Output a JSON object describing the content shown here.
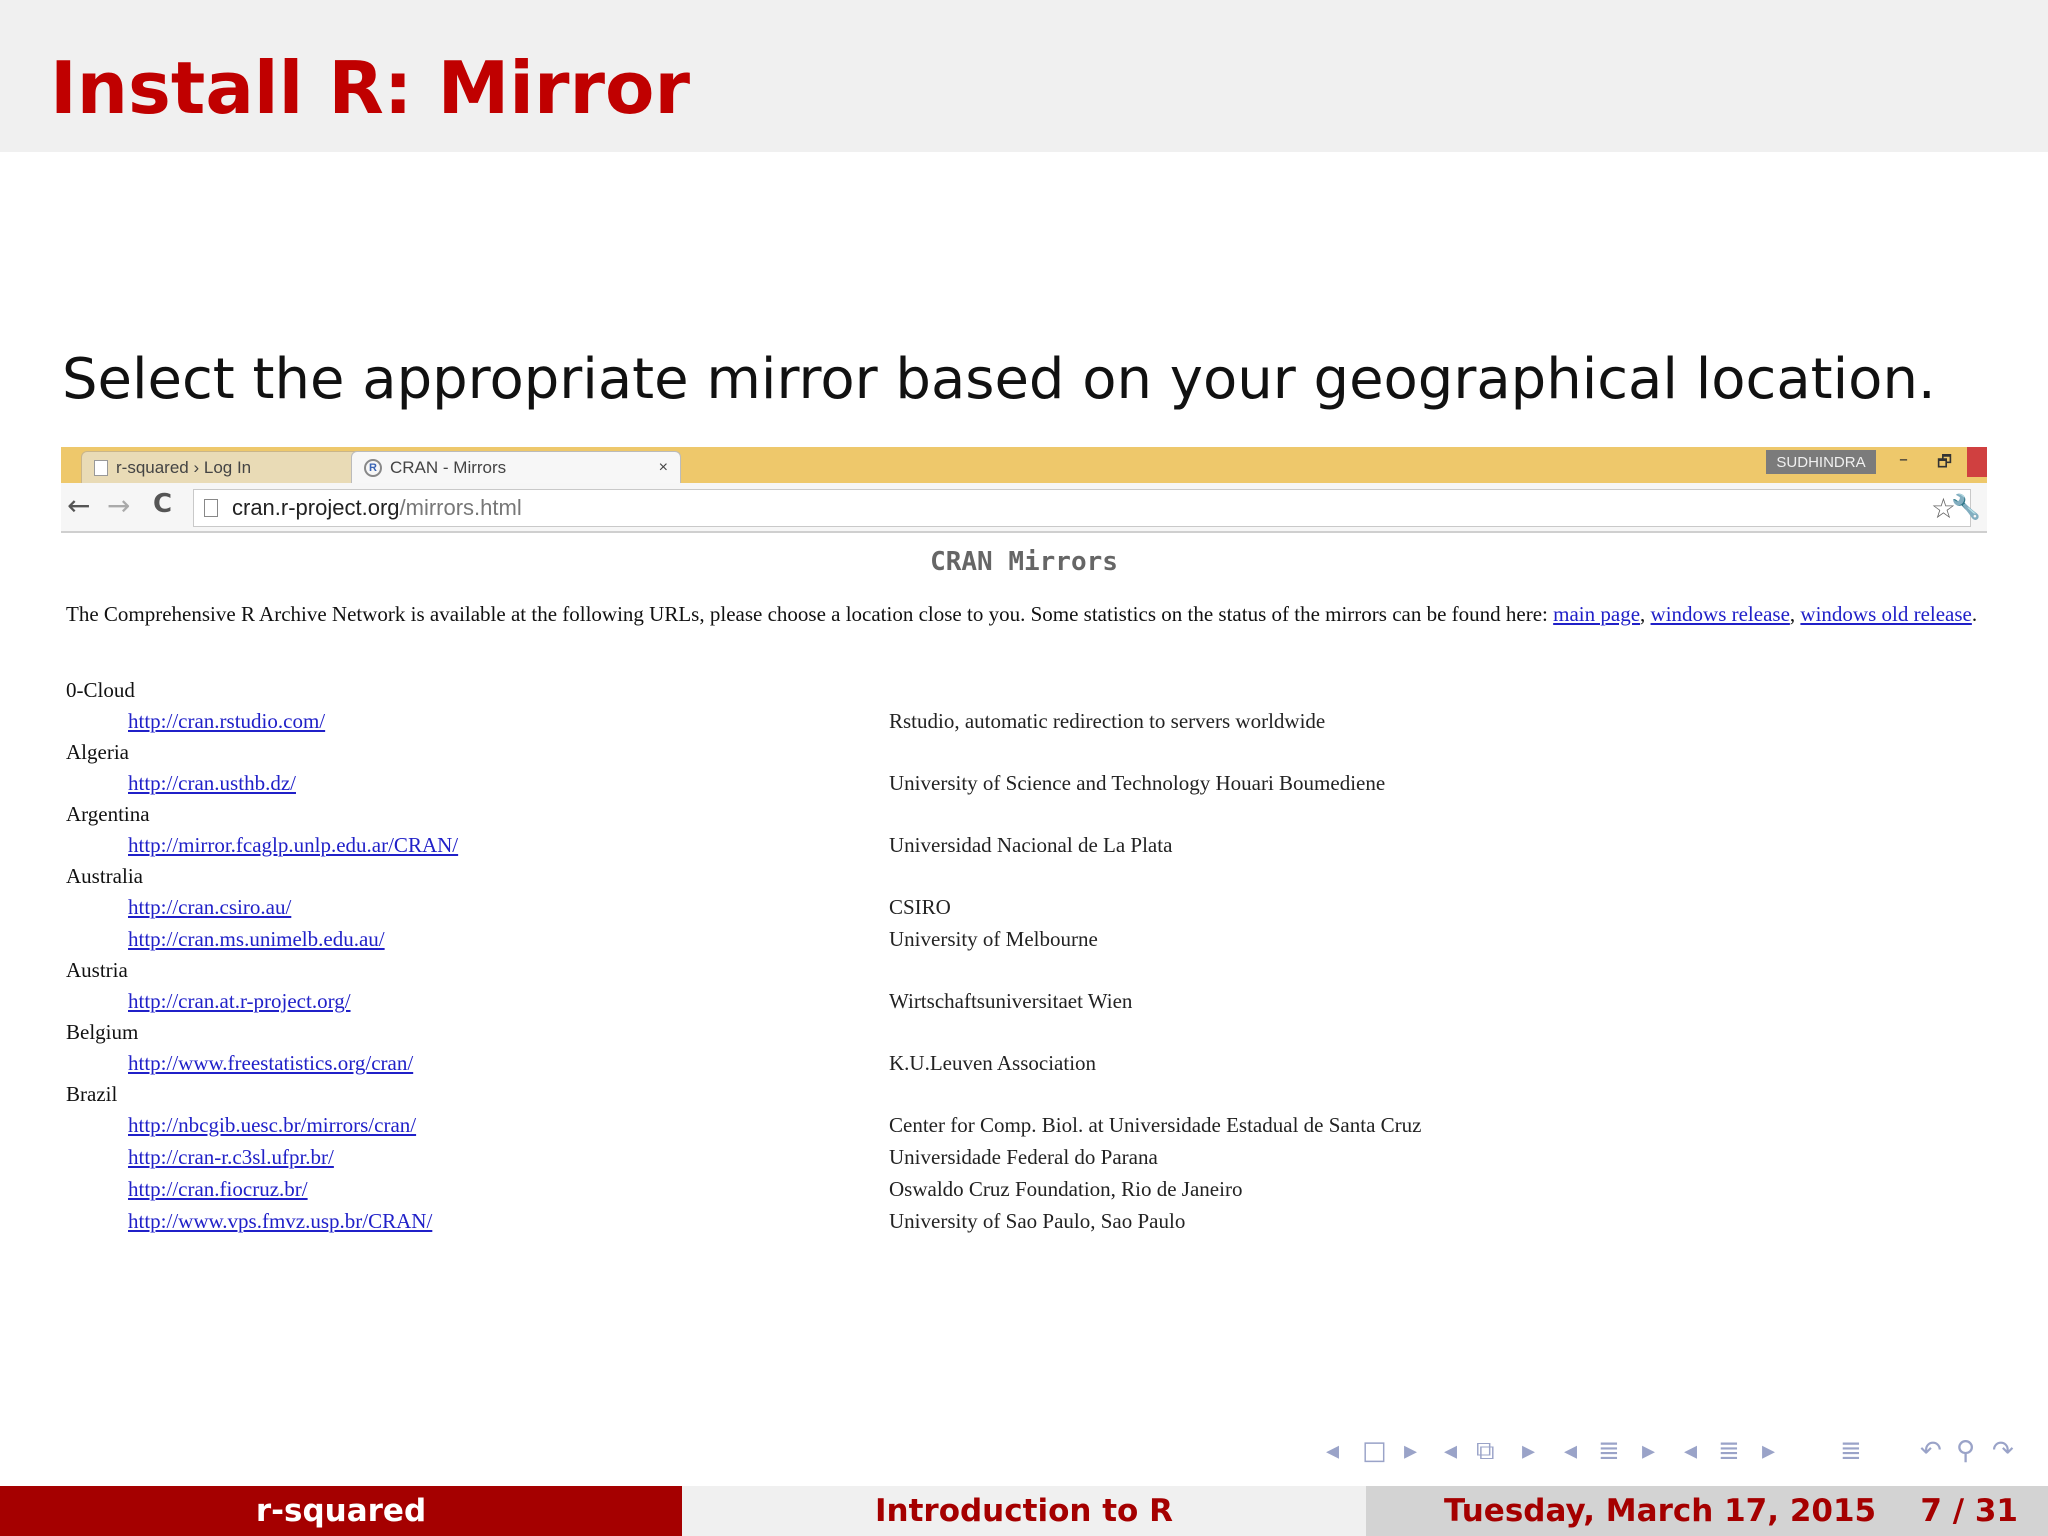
{
  "slide": {
    "title": "Install R: Mirror",
    "subtitle": "Select the appropriate mirror based on your geographical location."
  },
  "browser": {
    "tabs": [
      {
        "label": "r-squared › Log In",
        "active": false
      },
      {
        "label": "CRAN - Mirrors",
        "active": true
      }
    ],
    "user": "SUDHINDRA",
    "address": {
      "host": "cran.r-project.org",
      "path": "/mirrors.html"
    },
    "page": {
      "heading": "CRAN Mirrors",
      "intro": "The Comprehensive R Archive Network is available at the following URLs, please choose a location close to you. Some statistics on the status of the mirrors can be found here: ",
      "link_main": "main page",
      "link_windows": "windows release",
      "link_windows_old": "windows old release",
      "sep": ", ",
      "end": ".",
      "countries": [
        {
          "name": "0-Cloud",
          "mirrors": [
            {
              "url": "http://cran.rstudio.com/",
              "org": "Rstudio, automatic redirection to servers worldwide"
            }
          ]
        },
        {
          "name": "Algeria",
          "mirrors": [
            {
              "url": "http://cran.usthb.dz/",
              "org": "University of Science and Technology Houari Boumediene"
            }
          ]
        },
        {
          "name": "Argentina",
          "mirrors": [
            {
              "url": "http://mirror.fcaglp.unlp.edu.ar/CRAN/",
              "org": "Universidad Nacional de La Plata"
            }
          ]
        },
        {
          "name": "Australia",
          "mirrors": [
            {
              "url": "http://cran.csiro.au/",
              "org": "CSIRO"
            },
            {
              "url": "http://cran.ms.unimelb.edu.au/",
              "org": "University of Melbourne"
            }
          ]
        },
        {
          "name": "Austria",
          "mirrors": [
            {
              "url": "http://cran.at.r-project.org/",
              "org": "Wirtschaftsuniversitaet Wien"
            }
          ]
        },
        {
          "name": "Belgium",
          "mirrors": [
            {
              "url": "http://www.freestatistics.org/cran/",
              "org": "K.U.Leuven Association"
            }
          ]
        },
        {
          "name": "Brazil",
          "mirrors": [
            {
              "url": "http://nbcgib.uesc.br/mirrors/cran/",
              "org": "Center for Comp. Biol. at Universidade Estadual de Santa Cruz"
            },
            {
              "url": "http://cran-r.c3sl.ufpr.br/",
              "org": "Universidade Federal do Parana"
            },
            {
              "url": "http://cran.fiocruz.br/",
              "org": "Oswaldo Cruz Foundation, Rio de Janeiro"
            },
            {
              "url": "http://www.vps.fmvz.usp.br/CRAN/",
              "org": "University of Sao Paulo, Sao Paulo"
            }
          ]
        }
      ]
    }
  },
  "footer": {
    "author": "r-squared",
    "title": "Introduction to R",
    "date": "Tuesday, March 17, 2015",
    "page": "7 / 31"
  },
  "icons": {
    "tab_close": "×",
    "minimize": "–",
    "restore": "🗗",
    "back": "←",
    "forward": "→",
    "reload": "C",
    "star": "☆",
    "extension": "🔧",
    "r_logo": "R"
  },
  "colors": {
    "title_red": "#c00000",
    "footer_red": "#a50000",
    "link_blue": "#2020c8",
    "tabstrip": "#eec86b"
  }
}
